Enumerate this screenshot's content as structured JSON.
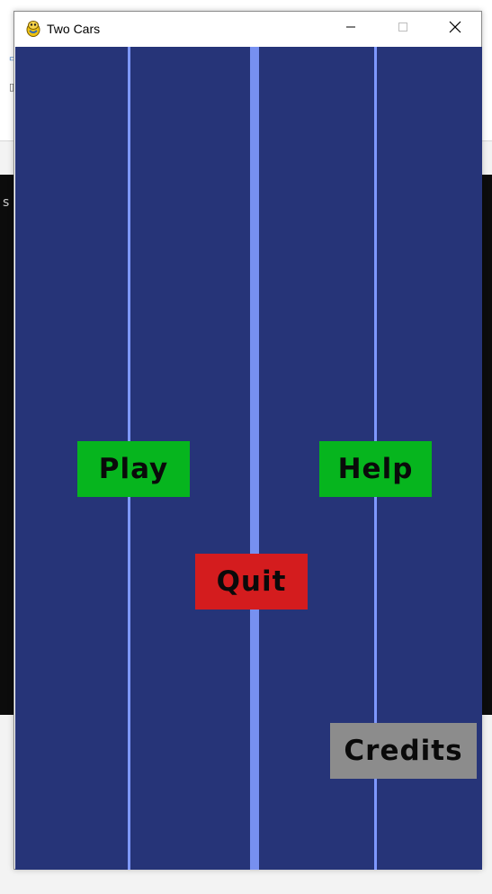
{
  "window": {
    "title": "Two Cars",
    "icon": "pygame-snake-icon",
    "controls": {
      "minimize_icon": "minimize-icon",
      "maximize_icon": "maximize-icon",
      "close_icon": "close-icon"
    }
  },
  "background": {
    "terminal_fragment": "s py"
  },
  "game": {
    "colors": {
      "road": "#263478",
      "lane_line": "#7e98ff",
      "play": "#06b51e",
      "help": "#06b51e",
      "quit": "#d41c1e",
      "credits": "#8c8c8c"
    },
    "menu": {
      "play": "Play",
      "help": "Help",
      "quit": "Quit",
      "credits": "Credits"
    }
  }
}
